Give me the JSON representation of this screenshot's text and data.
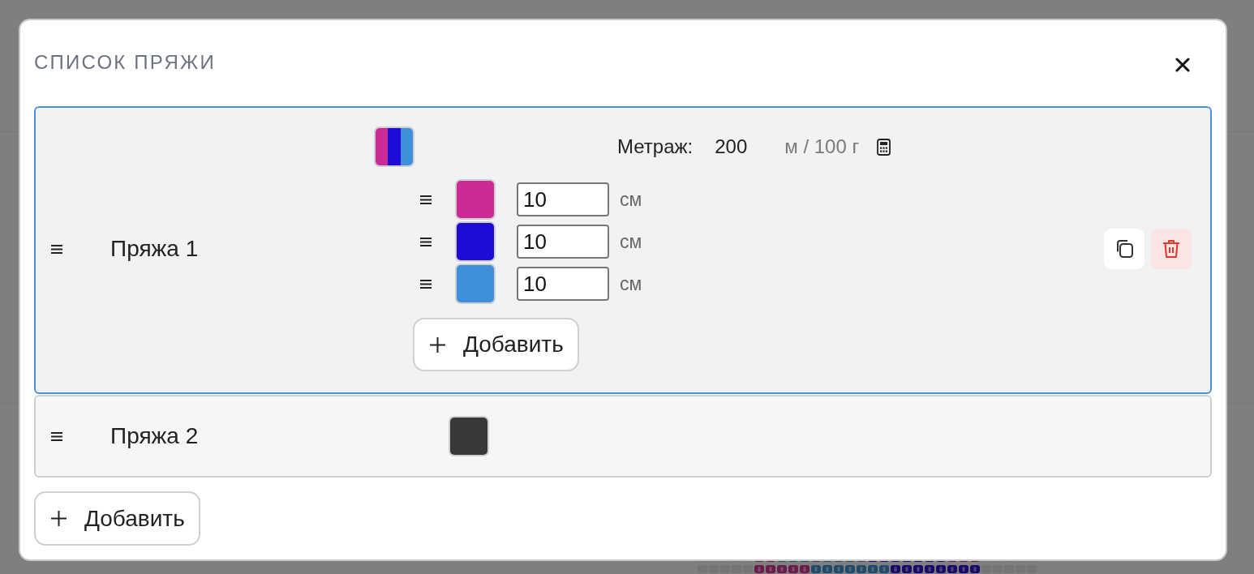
{
  "modal": {
    "title": "СПИСОК ПРЯЖИ"
  },
  "yarns": [
    {
      "name": "Пряжа 1",
      "selected": true,
      "metrage": {
        "label": "Метраж:",
        "value": "200",
        "unit": "м / 100 г"
      },
      "colors": [
        {
          "color": "#cc2a94",
          "length": "10",
          "unit": "см"
        },
        {
          "color": "#1d0bd6",
          "length": "10",
          "unit": "см"
        },
        {
          "color": "#3f8fdb",
          "length": "10",
          "unit": "см"
        }
      ],
      "add_color_button": "Добавить"
    },
    {
      "name": "Пряжа 2",
      "selected": false,
      "colors": [
        {
          "color": "#38383a"
        }
      ]
    }
  ],
  "add_yarn_button": "Добавить"
}
